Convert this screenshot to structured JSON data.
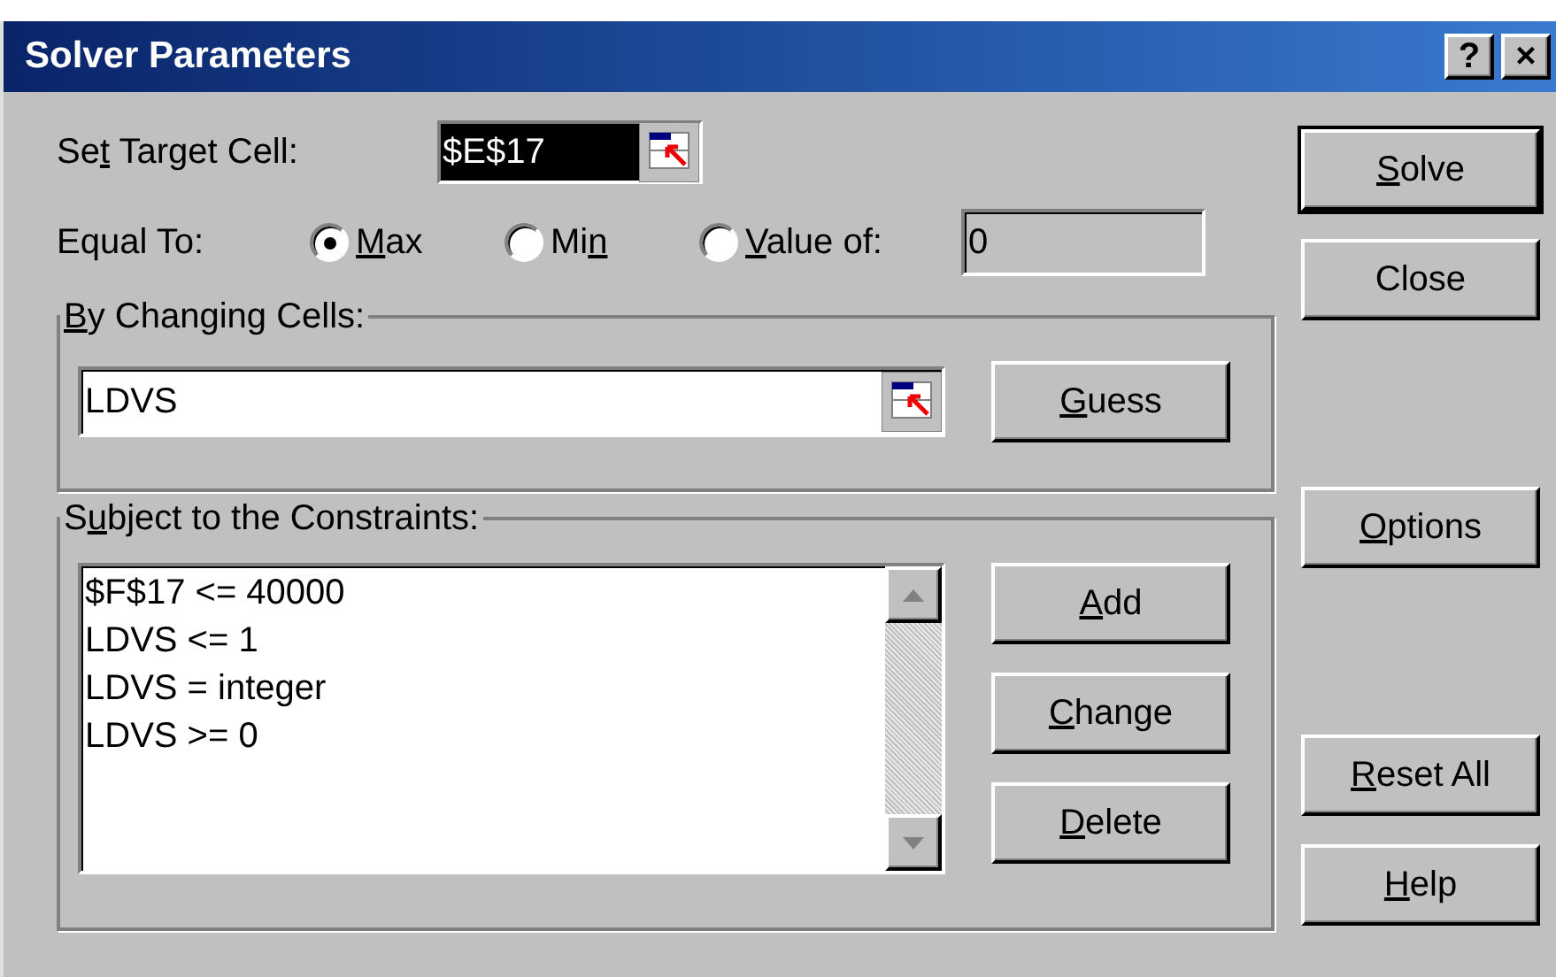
{
  "window": {
    "title": "Solver Parameters",
    "title_buttons": [
      "?",
      "×"
    ]
  },
  "target": {
    "label": {
      "pre": "Se",
      "key": "t",
      "post": " Target Cell:"
    },
    "value": "$E$17"
  },
  "equal_to": {
    "label": {
      "pre": "Equal To:"
    },
    "options": [
      {
        "label": {
          "key": "M",
          "post": "ax"
        },
        "selected": true
      },
      {
        "label": {
          "pre": "Mi",
          "key": "n"
        },
        "selected": false
      },
      {
        "label": {
          "key": "V",
          "post": "alue of:"
        },
        "selected": false
      }
    ],
    "value": "0"
  },
  "changing_cells": {
    "label": {
      "key": "B",
      "post": "y Changing Cells:"
    },
    "value": "LDVS",
    "button": {
      "key": "G",
      "post": "uess"
    }
  },
  "constraints": {
    "label": {
      "pre": "S",
      "key": "u",
      "post": "bject to the Constraints:"
    },
    "items": [
      "$F$17 <= 40000",
      "LDVS <= 1",
      "LDVS = integer",
      "LDVS >= 0"
    ],
    "buttons": [
      {
        "key": "A",
        "post": "dd"
      },
      {
        "key": "C",
        "post": "hange"
      },
      {
        "key": "D",
        "post": "elete"
      }
    ]
  },
  "side_buttons": [
    {
      "label": {
        "key": "S",
        "post": "olve"
      },
      "default": true
    },
    {
      "label": {
        "pre": "Close"
      },
      "default": false
    },
    {
      "label": {
        "key": "O",
        "post": "ptions"
      },
      "default": false
    },
    {
      "label": {
        "key": "R",
        "post": "eset All"
      },
      "default": false
    },
    {
      "label": {
        "key": "H",
        "post": "elp"
      },
      "default": false
    }
  ]
}
